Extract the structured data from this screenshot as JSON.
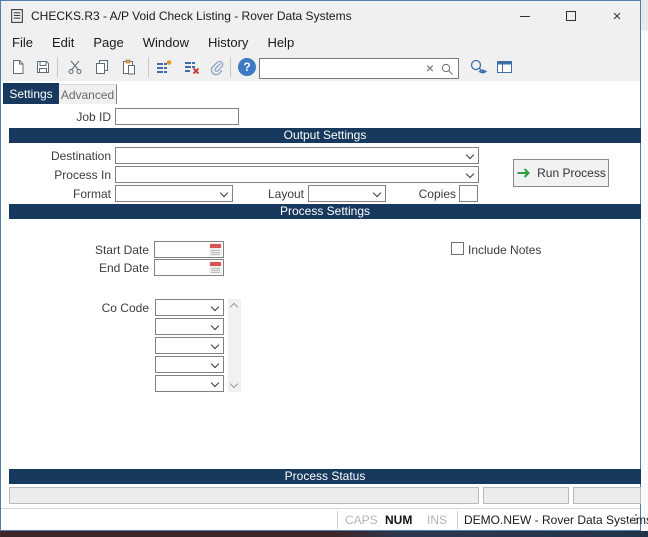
{
  "window": {
    "title": "CHECKS.R3 - A/P Void Check Listing - Rover Data Systems",
    "controls": [
      "minimize",
      "maximize",
      "close"
    ]
  },
  "menu": {
    "items": [
      "File",
      "Edit",
      "Page",
      "Window",
      "History",
      "Help"
    ]
  },
  "toolbar": {
    "search": {
      "value": "",
      "placeholder": ""
    },
    "icons": [
      "new-document",
      "save",
      "cut",
      "copy",
      "paste",
      "add-rows",
      "delete-rows",
      "attachment",
      "help",
      "clear-search",
      "search",
      "search-preview",
      "layout-view"
    ]
  },
  "tabs": {
    "items": [
      "Settings",
      "Advanced"
    ],
    "active": "Settings"
  },
  "form": {
    "job_id_label": "Job ID",
    "job_id_value": "",
    "output": {
      "header": "Output Settings",
      "destination_label": "Destination",
      "destination_value": "",
      "process_in_label": "Process In",
      "process_in_value": "",
      "format_label": "Format",
      "format_value": "",
      "layout_label": "Layout",
      "layout_value": "",
      "copies_label": "Copies",
      "copies_value": "",
      "run_process_label": "Run Process"
    },
    "process": {
      "header": "Process Settings",
      "start_date_label": "Start Date",
      "start_date_value": "",
      "end_date_label": "End Date",
      "end_date_value": "",
      "include_notes_label": "Include Notes",
      "include_notes_checked": false,
      "co_code_label": "Co Code",
      "co_code_values": [
        "",
        "",
        "",
        "",
        ""
      ]
    },
    "status_section": {
      "header": "Process Status",
      "message_value": "",
      "field2_value": "",
      "field3_value": ""
    }
  },
  "status_bar": {
    "caps_label": "CAPS",
    "caps_active": false,
    "num_label": "NUM",
    "num_active": true,
    "ins_label": "INS",
    "ins_active": false,
    "session_label": "DEMO.NEW - Rover Data Systems"
  },
  "colors": {
    "header_navy": "#17395e",
    "active_tab_navy": "#17395e",
    "window_border_blue": "#4f7dae",
    "chrome_gray": "#f0f0f0",
    "run_arrow_green": "#2f9e44",
    "calendar_red": "#d9534f",
    "help_blue": "#3d79c4",
    "toolbar_icon_blue": "#3e6fa6",
    "desktop_maroon": "#3c2628",
    "desktop_navy": "#233349"
  }
}
